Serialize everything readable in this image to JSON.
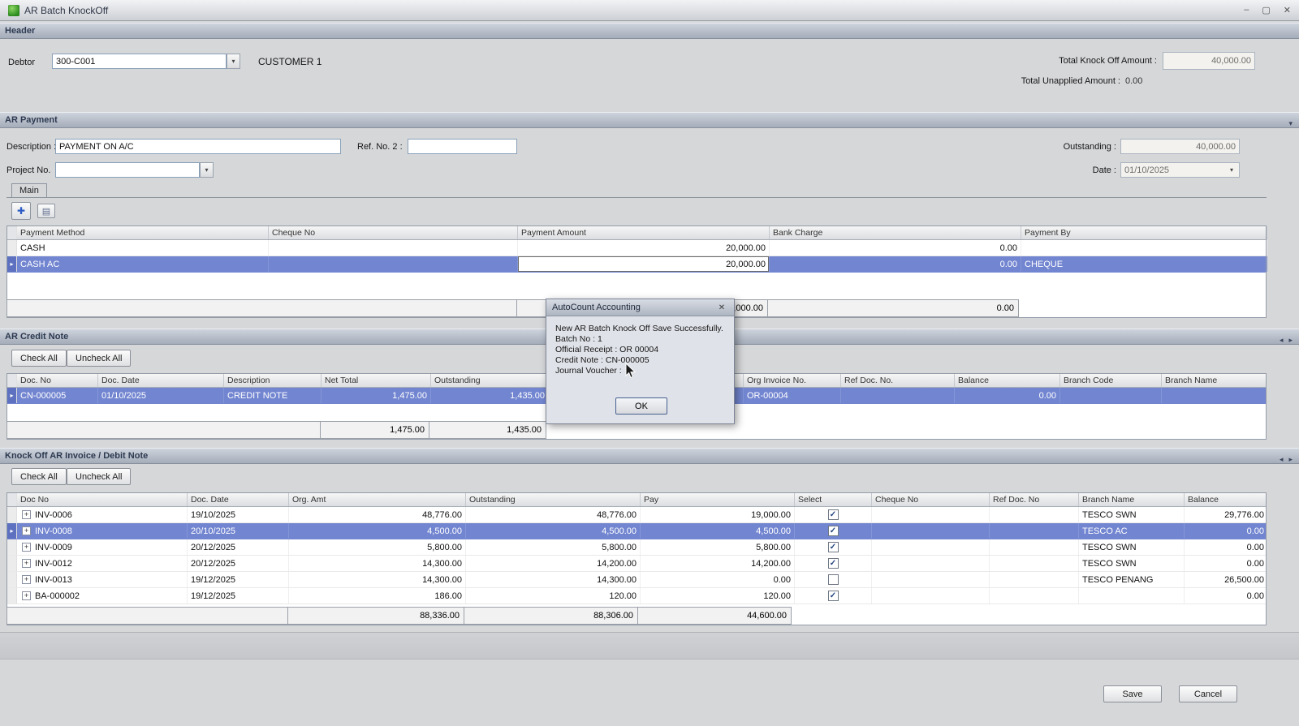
{
  "window": {
    "title": "AR Batch KnockOff"
  },
  "icons": {
    "dropdown": "▾",
    "add": "✚",
    "edit": "▤",
    "nav_left": "◂",
    "nav_right": "▸",
    "row_marker": "▸",
    "expand": "+",
    "check": "✓",
    "minimize": "–",
    "maximize": "▢",
    "close": "✕"
  },
  "sections": {
    "header": "Header",
    "payment": "AR Payment",
    "credit_note": "AR Credit Note",
    "knockoff": "Knock Off AR Invoice / Debit Note"
  },
  "header": {
    "debtor_label": "Debtor",
    "debtor_value": "300-C001",
    "debtor_name": "CUSTOMER 1",
    "total_knockoff_label": "Total Knock Off Amount :",
    "total_knockoff_value": "40,000.00",
    "total_unapplied_label": "Total Unapplied Amount :",
    "total_unapplied_value": "0.00"
  },
  "payment": {
    "description_label": "Description :",
    "description_value": "PAYMENT ON A/C",
    "ref_no_label": "Ref. No. 2 :",
    "ref_no_value": "",
    "project_label": "Project No.",
    "project_value": "",
    "outstanding_label": "Outstanding :",
    "outstanding_value": "40,000.00",
    "date_label": "Date :",
    "date_value": "01/10/2025",
    "tab": "Main",
    "columns": [
      "Payment Method",
      "Cheque No",
      "Payment Amount",
      "Bank Charge",
      "Payment By"
    ],
    "rows": [
      {
        "method": "CASH",
        "cheque": "",
        "amount": "20,000.00",
        "charge": "0.00",
        "by": ""
      },
      {
        "method": "CASH AC",
        "cheque": "",
        "amount": "20,000.00",
        "charge": "0.00",
        "by": "CHEQUE"
      }
    ],
    "total_amount": "40,000.00",
    "total_charge": "0.00"
  },
  "credit_note": {
    "check_all": "Check All",
    "uncheck_all": "Uncheck All",
    "columns": [
      "Doc. No",
      "Doc. Date",
      "Description",
      "Net Total",
      "Outstanding",
      "",
      "",
      "Org Invoice No.",
      "Ref Doc. No.",
      "Balance",
      "Branch Code",
      "Branch Name"
    ],
    "row": {
      "doc_no": "CN-000005",
      "doc_date": "01/10/2025",
      "description": "CREDIT NOTE",
      "net_total": "1,475.00",
      "outstanding": "1,435.00",
      "col6": "",
      "col7": "",
      "org_invoice": "OR-00004",
      "ref_doc": "",
      "balance": "0.00",
      "branch_code": "",
      "branch_name": ""
    },
    "total_net": "1,475.00",
    "total_outstanding": "1,435.00"
  },
  "dialog": {
    "title": "AutoCount Accounting",
    "lines": [
      "New AR Batch Knock Off Save Successfully.",
      "Batch No : 1",
      "Official Receipt : OR 00004",
      "Credit Note : CN-000005",
      "Journal Voucher :"
    ],
    "ok": "OK"
  },
  "knockoff": {
    "check_all": "Check All",
    "uncheck_all": "Uncheck All",
    "columns": [
      "Doc No",
      "Doc. Date",
      "Org. Amt",
      "Outstanding",
      "Pay",
      "Select",
      "Cheque No",
      "Ref Doc. No",
      "Branch Name",
      "Balance"
    ],
    "rows": [
      {
        "doc_no": "INV-0006",
        "doc_date": "19/10/2025",
        "org_amt": "48,776.00",
        "outstanding": "48,776.00",
        "pay": "19,000.00",
        "checked": true,
        "cheque": "",
        "ref_doc": "",
        "branch": "TESCO SWN",
        "balance": "29,776.00"
      },
      {
        "doc_no": "INV-0008",
        "doc_date": "20/10/2025",
        "org_amt": "4,500.00",
        "outstanding": "4,500.00",
        "pay": "4,500.00",
        "checked": true,
        "cheque": "",
        "ref_doc": "",
        "branch": "TESCO AC",
        "balance": "0.00"
      },
      {
        "doc_no": "INV-0009",
        "doc_date": "20/12/2025",
        "org_amt": "5,800.00",
        "outstanding": "5,800.00",
        "pay": "5,800.00",
        "checked": true,
        "cheque": "",
        "ref_doc": "",
        "branch": "TESCO SWN",
        "balance": "0.00"
      },
      {
        "doc_no": "INV-0012",
        "doc_date": "20/12/2025",
        "org_amt": "14,300.00",
        "outstanding": "14,200.00",
        "pay": "14,200.00",
        "checked": true,
        "cheque": "",
        "ref_doc": "",
        "branch": "TESCO SWN",
        "balance": "0.00"
      },
      {
        "doc_no": "INV-0013",
        "doc_date": "19/12/2025",
        "org_amt": "14,300.00",
        "outstanding": "14,300.00",
        "pay": "0.00",
        "checked": false,
        "cheque": "",
        "ref_doc": "",
        "branch": "TESCO PENANG",
        "balance": "26,500.00"
      },
      {
        "doc_no": "BA-000002",
        "doc_date": "19/12/2025",
        "org_amt": "186.00",
        "outstanding": "120.00",
        "pay": "120.00",
        "checked": true,
        "cheque": "",
        "ref_doc": "",
        "branch": "",
        "balance": "0.00"
      }
    ],
    "total_org": "88,336.00",
    "total_outstanding": "88,306.00",
    "total_pay": "44,600.00"
  },
  "footer_buttons": {
    "save": "Save",
    "cancel": "Cancel"
  }
}
